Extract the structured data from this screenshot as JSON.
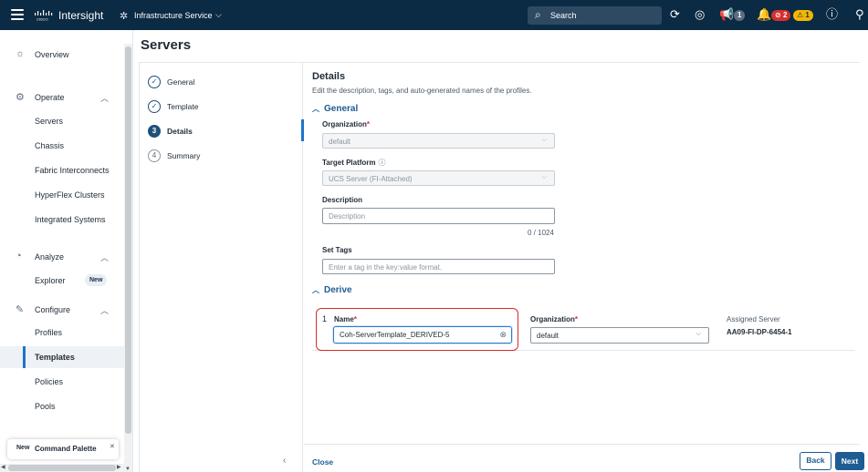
{
  "topbar": {
    "brand": "Intersight",
    "service": "Infrastructure Service",
    "search_label": "Search",
    "announce_count": "1",
    "critical_count": "2",
    "warning_count": "1",
    "brand_color": "#0b2a43"
  },
  "sidebar": {
    "overview": "Overview",
    "operate": "Operate",
    "operate_items": [
      "Servers",
      "Chassis",
      "Fabric Interconnects",
      "HyperFlex Clusters",
      "Integrated Systems"
    ],
    "analyze": "Analyze",
    "explorer": "Explorer",
    "explorer_badge": "New",
    "configure": "Configure",
    "configure_items": [
      "Profiles",
      "Templates",
      "Policies",
      "Pools"
    ],
    "active_item": "Templates",
    "palette_new": "New",
    "palette_label": "Command Palette"
  },
  "page": {
    "title": "Servers"
  },
  "wizard": {
    "steps": [
      {
        "label": "General",
        "state": "done"
      },
      {
        "label": "Template",
        "state": "done"
      },
      {
        "number": "3",
        "label": "Details",
        "state": "current"
      },
      {
        "number": "4",
        "label": "Summary",
        "state": "todo"
      }
    ]
  },
  "details": {
    "title": "Details",
    "subtitle": "Edit the description, tags, and auto-generated names of the profiles.",
    "general_heading": "General",
    "org_label": "Organization",
    "org_value": "default",
    "platform_label": "Target Platform",
    "platform_value": "UCS Server (FI-Attached)",
    "desc_label": "Description",
    "desc_placeholder": "Description",
    "desc_counter": "0 / 1024",
    "tags_label": "Set Tags",
    "tags_placeholder": "Enter a tag in the key:value format.",
    "derive_heading": "Derive",
    "row_number": "1",
    "name_label": "Name",
    "name_value": "Coh-ServerTemplate_DERIVED-5",
    "derive_org_label": "Organization",
    "derive_org_value": "default",
    "assigned_label": "Assigned Server",
    "assigned_value": "AA09-FI-DP-6454-1"
  },
  "footer": {
    "close": "Close",
    "back": "Back",
    "next": "Next"
  },
  "colors": {
    "accent": "#1f5c93",
    "highlight": "#d52b2b",
    "critical": "#d62e2e",
    "warning": "#f2b705"
  }
}
